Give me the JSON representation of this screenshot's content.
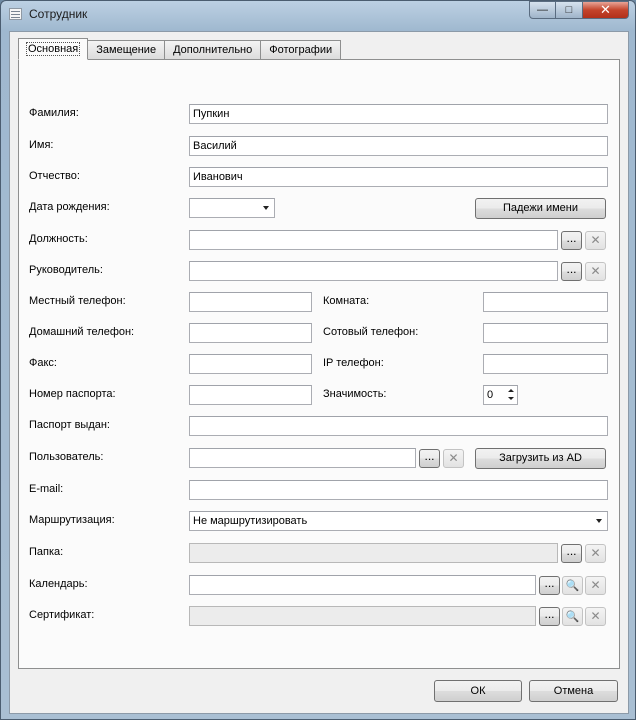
{
  "window": {
    "title": "Сотрудник"
  },
  "tabs": [
    {
      "label": "Основная"
    },
    {
      "label": "Замещение"
    },
    {
      "label": "Дополнительно"
    },
    {
      "label": "Фотографии"
    }
  ],
  "form": {
    "last_name": {
      "label": "Фамилия:",
      "value": "Пупкин"
    },
    "first_name": {
      "label": "Имя:",
      "value": "Василий"
    },
    "middle_name": {
      "label": "Отчество:",
      "value": "Иванович"
    },
    "birth_date": {
      "label": "Дата рождения:",
      "value": ""
    },
    "name_cases_button": "Падежи имени",
    "position": {
      "label": "Должность:",
      "value": ""
    },
    "manager": {
      "label": "Руководитель:",
      "value": ""
    },
    "local_phone": {
      "label": "Местный телефон:",
      "value": ""
    },
    "room": {
      "label": "Комната:",
      "value": ""
    },
    "home_phone": {
      "label": "Домашний телефон:",
      "value": ""
    },
    "mobile_phone": {
      "label": "Сотовый телефон:",
      "value": ""
    },
    "fax": {
      "label": "Факс:",
      "value": ""
    },
    "ip_phone": {
      "label": "IP телефон:",
      "value": ""
    },
    "passport_number": {
      "label": "Номер паспорта:",
      "value": ""
    },
    "importance": {
      "label": "Значимость:",
      "value": "0"
    },
    "passport_issued": {
      "label": "Паспорт выдан:",
      "value": ""
    },
    "user": {
      "label": "Пользователь:",
      "value": ""
    },
    "load_ad_button": "Загрузить из AD",
    "email": {
      "label": "E-mail:",
      "value": ""
    },
    "routing": {
      "label": "Маршрутизация:",
      "value": "Не маршрутизировать"
    },
    "folder": {
      "label": "Папка:",
      "value": ""
    },
    "calendar": {
      "label": "Календарь:",
      "value": ""
    },
    "certificate": {
      "label": "Сертификат:",
      "value": ""
    }
  },
  "common": {
    "browse": "...",
    "clear": "✕",
    "search": "🔍"
  },
  "footer": {
    "ok": "ОК",
    "cancel": "Отмена"
  }
}
